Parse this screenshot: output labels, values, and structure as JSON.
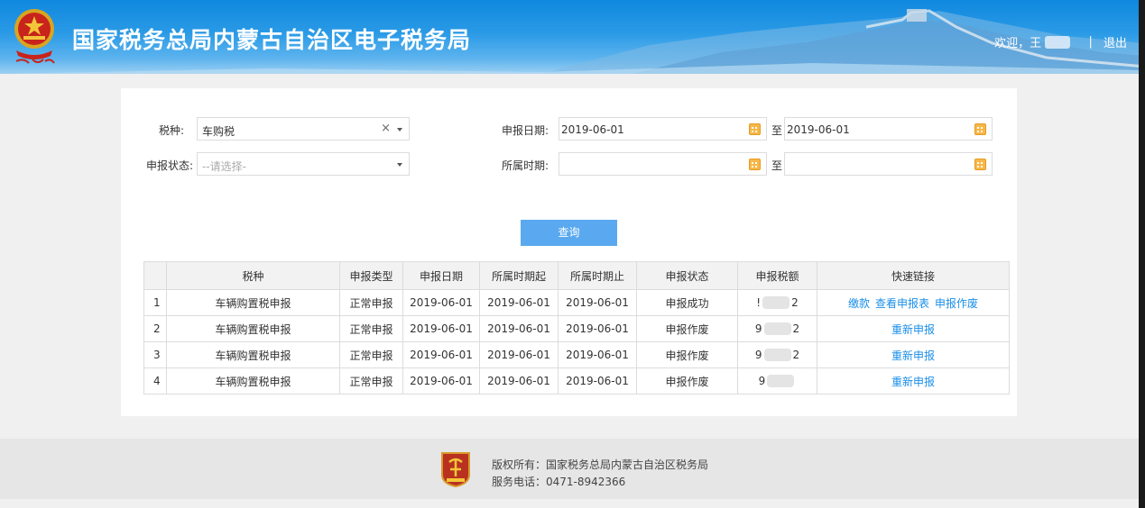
{
  "header": {
    "title": "国家税务总局内蒙古自治区电子税务局",
    "welcome": "欢迎，王",
    "separator": "|",
    "logout": "退出"
  },
  "filters": {
    "tax_type_label": "税种:",
    "tax_type_value": "车购税",
    "tax_type_clear": "×",
    "status_label": "申报状态:",
    "status_placeholder": "--请选择-",
    "declare_date_label": "申报日期:",
    "declare_date_start": "2019-06-01",
    "declare_date_to": "至",
    "declare_date_end": "2019-06-01",
    "period_label": "所属时期:",
    "period_start": "",
    "period_to": "至",
    "period_end": ""
  },
  "query_button": "查询",
  "table": {
    "headers": [
      "",
      "税种",
      "申报类型",
      "申报日期",
      "所属时期起",
      "所属时期止",
      "申报状态",
      "申报税额",
      "快速链接"
    ],
    "rows": [
      {
        "idx": "1",
        "tax": "车辆购置税申报",
        "type": "正常申报",
        "date": "2019-06-01",
        "start": "2019-06-01",
        "end": "2019-06-01",
        "status": "申报成功",
        "amount_prefix": "!",
        "amount_suffix": "2",
        "links": [
          "缴款",
          "查看申报表",
          "申报作废"
        ]
      },
      {
        "idx": "2",
        "tax": "车辆购置税申报",
        "type": "正常申报",
        "date": "2019-06-01",
        "start": "2019-06-01",
        "end": "2019-06-01",
        "status": "申报作废",
        "amount_prefix": "9",
        "amount_suffix": "2",
        "links": [
          "重新申报"
        ]
      },
      {
        "idx": "3",
        "tax": "车辆购置税申报",
        "type": "正常申报",
        "date": "2019-06-01",
        "start": "2019-06-01",
        "end": "2019-06-01",
        "status": "申报作废",
        "amount_prefix": "9",
        "amount_suffix": "2",
        "links": [
          "重新申报"
        ]
      },
      {
        "idx": "4",
        "tax": "车辆购置税申报",
        "type": "正常申报",
        "date": "2019-06-01",
        "start": "2019-06-01",
        "end": "2019-06-01",
        "status": "申报作废",
        "amount_prefix": "9",
        "amount_suffix": "",
        "links": [
          "重新申报"
        ]
      }
    ]
  },
  "footer": {
    "copyright": "版权所有：国家税务总局内蒙古自治区税务局",
    "phone": "服务电话：0471-8942366"
  },
  "colors": {
    "header_blue": "#0f88de",
    "link_blue": "#1a8ee8",
    "button_blue": "#5aa9f0",
    "calendar_orange": "#f7b84a",
    "footer_logo_red": "#b8321f"
  },
  "icons": {
    "emblem": "national-emblem-icon",
    "calendar": "calendar-icon",
    "footer_logo": "tax-badge-icon"
  }
}
